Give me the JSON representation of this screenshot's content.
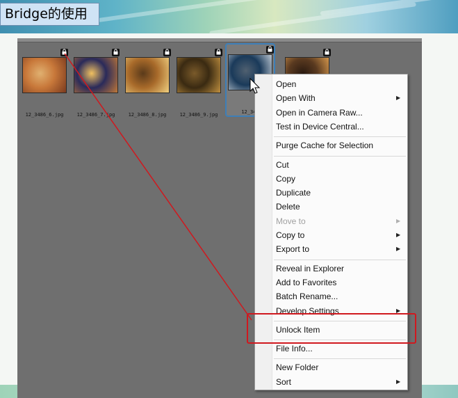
{
  "slide": {
    "title": "Bridge的使用"
  },
  "thumbnails": [
    {
      "filename": "12_3486_6.jpg",
      "locked": true,
      "selected": false,
      "colors": [
        "#c8783a",
        "#7a3a1e",
        "#e0b070"
      ]
    },
    {
      "filename": "12_3486_7.jpg",
      "locked": true,
      "selected": false,
      "colors": [
        "#2a2a5a",
        "#c07838",
        "#f0c060"
      ]
    },
    {
      "filename": "12_3486_8.jpg",
      "locked": true,
      "selected": false,
      "colors": [
        "#a86a2a",
        "#f0d080",
        "#5a3a1a"
      ]
    },
    {
      "filename": "12_3486_9.jpg",
      "locked": true,
      "selected": false,
      "colors": [
        "#3a2a12",
        "#c09040",
        "#7a5a2a"
      ]
    },
    {
      "filename": "12_348",
      "locked": true,
      "selected": true,
      "colors": [
        "#1a3a5a",
        "#d0d8e0",
        "#506070"
      ]
    },
    {
      "filename": "",
      "locked": true,
      "selected": false,
      "colors": [
        "#5a3a20",
        "#e0a050",
        "#2a1a10"
      ]
    }
  ],
  "lock_glyph": "🔒",
  "context_menu": {
    "groups": [
      [
        {
          "label": "Open",
          "submenu": false,
          "disabled": false
        },
        {
          "label": "Open With",
          "submenu": true,
          "disabled": false
        },
        {
          "label": "Open in Camera Raw...",
          "submenu": false,
          "disabled": false
        },
        {
          "label": "Test in Device Central...",
          "submenu": false,
          "disabled": false
        }
      ],
      [
        {
          "label": "Purge Cache for Selection",
          "submenu": false,
          "disabled": false
        }
      ],
      [
        {
          "label": "Cut",
          "submenu": false,
          "disabled": false
        },
        {
          "label": "Copy",
          "submenu": false,
          "disabled": false
        },
        {
          "label": "Duplicate",
          "submenu": false,
          "disabled": false
        },
        {
          "label": "Delete",
          "submenu": false,
          "disabled": false
        },
        {
          "label": "Move to",
          "submenu": true,
          "disabled": true
        },
        {
          "label": "Copy to",
          "submenu": true,
          "disabled": false
        },
        {
          "label": "Export to",
          "submenu": true,
          "disabled": false
        }
      ],
      [
        {
          "label": "Reveal in Explorer",
          "submenu": false,
          "disabled": false
        },
        {
          "label": "Add to Favorites",
          "submenu": false,
          "disabled": false
        },
        {
          "label": "Batch Rename...",
          "submenu": false,
          "disabled": false
        },
        {
          "label": "Develop Settings",
          "submenu": true,
          "disabled": false
        }
      ],
      [
        {
          "label": "Unlock Item",
          "submenu": false,
          "disabled": false
        }
      ],
      [
        {
          "label": "File Info...",
          "submenu": false,
          "disabled": false
        }
      ],
      [
        {
          "label": "New Folder",
          "submenu": false,
          "disabled": false
        },
        {
          "label": "Sort",
          "submenu": true,
          "disabled": false
        }
      ]
    ]
  },
  "annotation": {
    "highlighted_item": "Unlock Item",
    "color": "#d0181e"
  },
  "submenu_glyph": "▶"
}
